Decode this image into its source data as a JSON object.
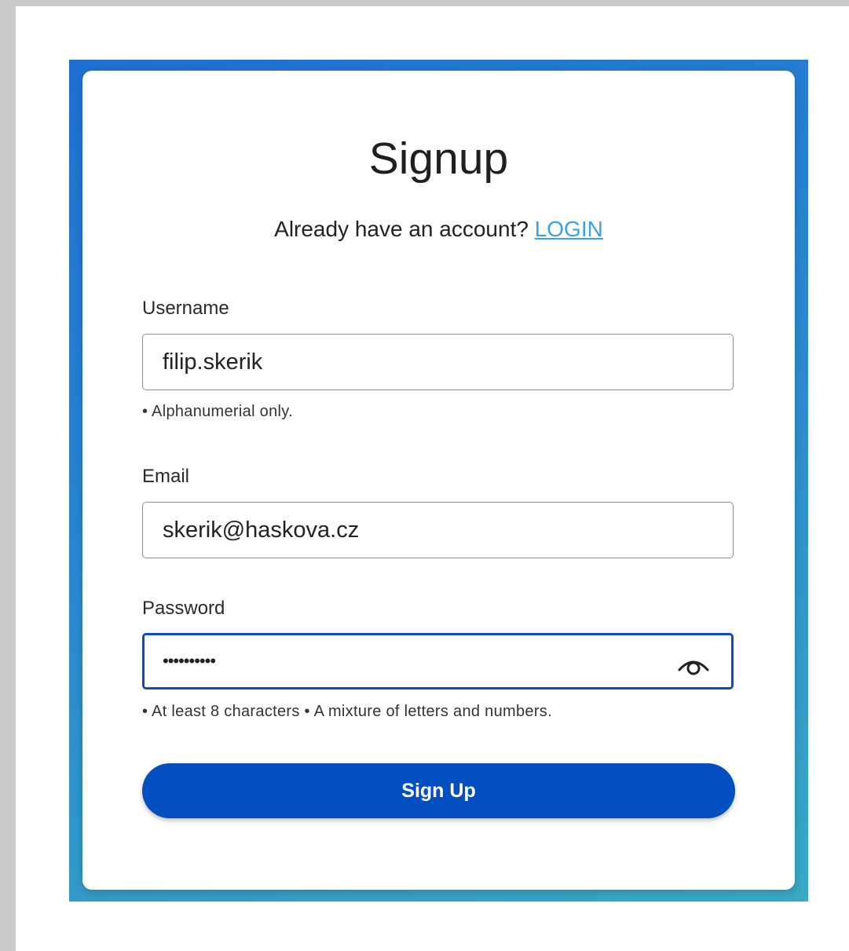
{
  "page": {
    "title": "Signup",
    "already_text": "Already have an account?",
    "login_link": "LOGIN"
  },
  "form": {
    "username": {
      "label": "Username",
      "value": "filip.skerik",
      "hint": "• Alphanumerial only."
    },
    "email": {
      "label": "Email",
      "value": "skerik@haskova.cz"
    },
    "password": {
      "label": "Password",
      "value": "••••••••••",
      "hint": "• At least 8 characters • A mixture of letters and numbers.",
      "toggle_icon": "eye-icon"
    },
    "submit_label": "Sign Up"
  },
  "colors": {
    "primary": "#044fc0",
    "focus_border": "#0a4cc1",
    "link": "#3aa0e8",
    "backdrop_start": "#1f6fd1",
    "backdrop_end": "#38a9c4"
  }
}
